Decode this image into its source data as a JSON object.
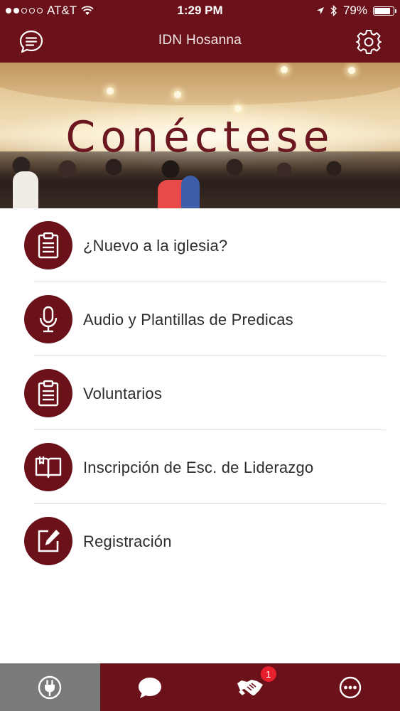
{
  "status_bar": {
    "carrier": "AT&T",
    "time": "1:29 PM",
    "battery": "79%",
    "battery_level": 0.79,
    "signal_bars_filled": 2,
    "signal_bars_total": 5
  },
  "header": {
    "title": "IDN Hosanna",
    "left_icon": "chat-menu-icon",
    "right_icon": "gear-icon"
  },
  "banner": {
    "text": "Conéctese"
  },
  "menu": {
    "items": [
      {
        "label": "¿Nuevo a la iglesia?",
        "icon": "clipboard-icon"
      },
      {
        "label": "Audio y Plantillas de Predicas",
        "icon": "microphone-icon"
      },
      {
        "label": "Voluntarios",
        "icon": "clipboard-icon"
      },
      {
        "label": "Inscripción de Esc. de Liderazgo",
        "icon": "book-icon"
      },
      {
        "label": "Registración",
        "icon": "edit-icon"
      }
    ]
  },
  "tabbar": {
    "tabs": [
      {
        "name": "connect",
        "icon": "plug-icon",
        "active": true
      },
      {
        "name": "messages",
        "icon": "chat-bubble-icon",
        "badge": "1"
      },
      {
        "name": "handshake",
        "icon": "handshake-icon"
      },
      {
        "name": "more",
        "icon": "more-icon"
      }
    ]
  },
  "colors": {
    "brand": "#6a1119",
    "active_tab": "#7a7a7a",
    "badge": "#e8202c"
  }
}
